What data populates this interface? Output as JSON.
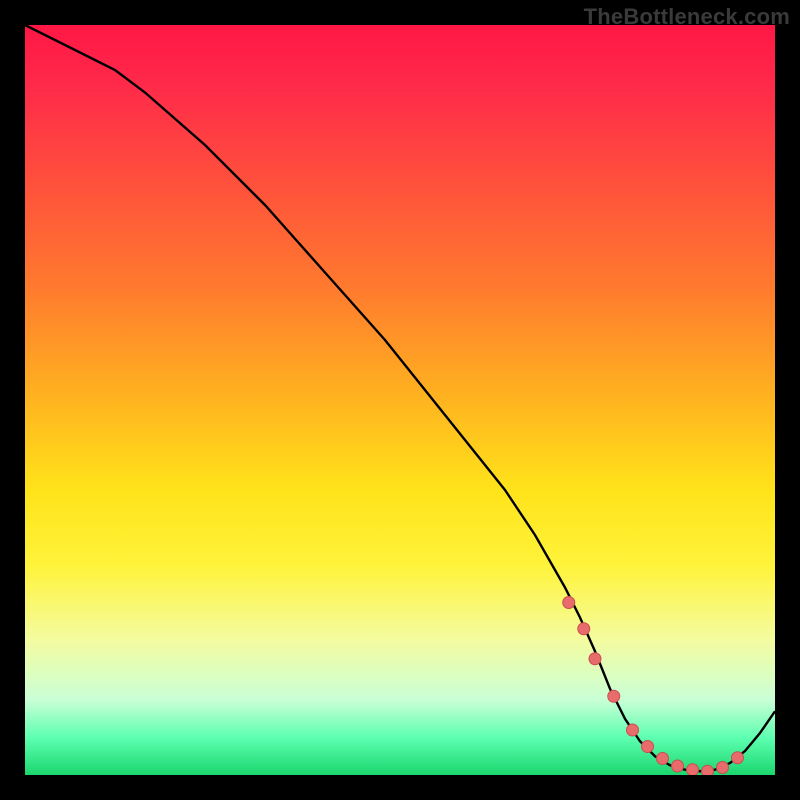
{
  "watermark": "TheBottleneck.com",
  "colors": {
    "bg": "#000000",
    "curve": "#000000",
    "marker_fill": "#e86c6c",
    "marker_stroke": "#c94f4f",
    "greenish": "#2fe07a"
  },
  "chart_data": {
    "type": "line",
    "title": "",
    "xlabel": "",
    "ylabel": "",
    "xlim": [
      0,
      100
    ],
    "ylim": [
      0,
      100
    ],
    "gradient_stops": [
      {
        "offset": 0.0,
        "color": "#ff1744"
      },
      {
        "offset": 0.08,
        "color": "#ff2a4a"
      },
      {
        "offset": 0.2,
        "color": "#ff4d3d"
      },
      {
        "offset": 0.35,
        "color": "#ff7a2e"
      },
      {
        "offset": 0.5,
        "color": "#ffb41f"
      },
      {
        "offset": 0.62,
        "color": "#ffe31a"
      },
      {
        "offset": 0.72,
        "color": "#fff33a"
      },
      {
        "offset": 0.82,
        "color": "#f4fca0"
      },
      {
        "offset": 0.9,
        "color": "#c9ffd6"
      },
      {
        "offset": 0.95,
        "color": "#5dffb0"
      },
      {
        "offset": 1.0,
        "color": "#1bd66e"
      }
    ],
    "series": [
      {
        "name": "curve",
        "x": [
          0,
          4,
          8,
          12,
          16,
          20,
          24,
          28,
          32,
          36,
          40,
          44,
          48,
          52,
          56,
          60,
          64,
          68,
          72,
          74,
          76,
          78,
          80,
          82,
          84,
          86,
          88,
          90,
          92,
          94,
          96,
          98,
          100
        ],
        "y": [
          100,
          98,
          96,
          94,
          91,
          87.5,
          84,
          80,
          76,
          71.5,
          67,
          62.5,
          58,
          53,
          48,
          43,
          38,
          32,
          25,
          21,
          16.5,
          11.5,
          7.5,
          4.5,
          2.5,
          1.3,
          0.7,
          0.5,
          0.7,
          1.6,
          3.2,
          5.6,
          8.5
        ]
      }
    ],
    "markers": {
      "name": "highlight-points",
      "x": [
        72.5,
        74.5,
        76.0,
        78.5,
        81.0,
        83.0,
        85.0,
        87.0,
        89.0,
        91.0,
        93.0,
        95.0
      ],
      "y": [
        23.0,
        19.5,
        15.5,
        10.5,
        6.0,
        3.8,
        2.2,
        1.2,
        0.7,
        0.5,
        1.0,
        2.3
      ]
    }
  }
}
